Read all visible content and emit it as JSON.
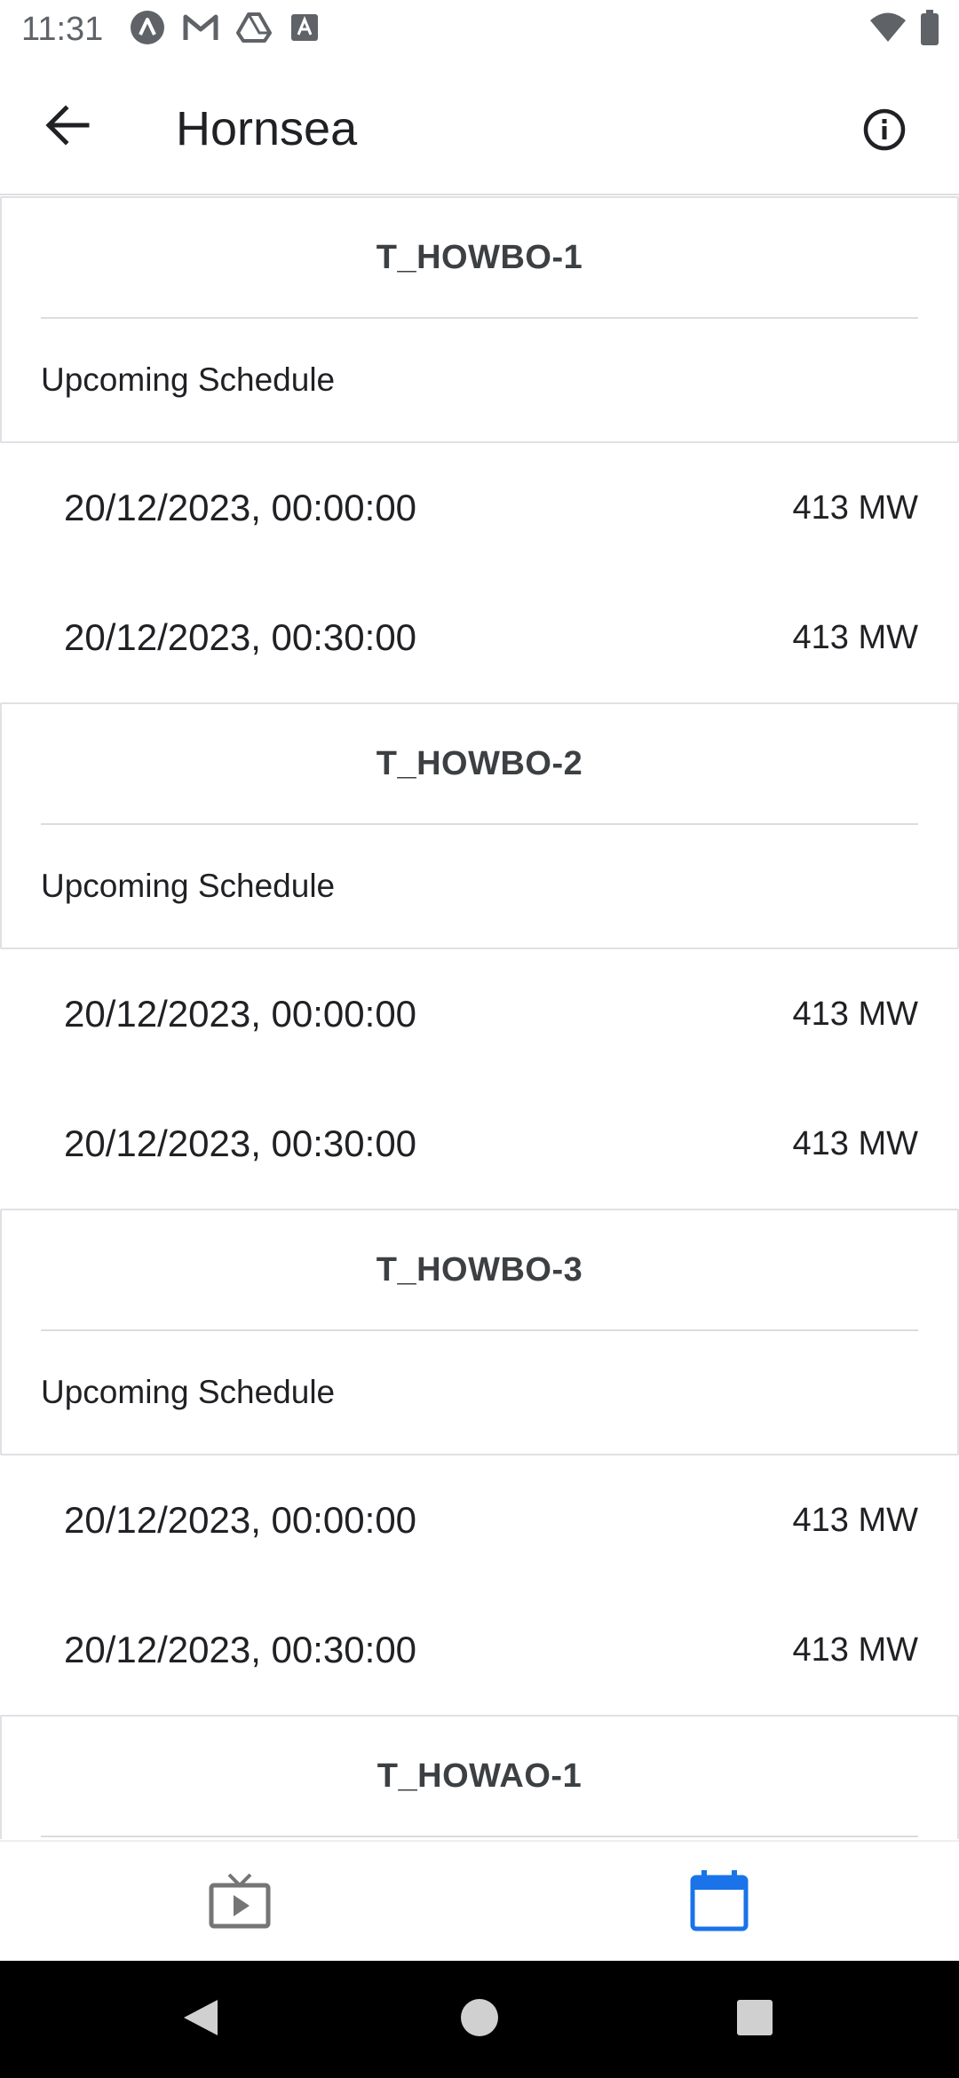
{
  "status_bar": {
    "time": "11:31",
    "left_icons": [
      "app-a-icon",
      "gmail-icon",
      "drive-icon",
      "font-a-icon"
    ],
    "right_icons": [
      "wifi-icon",
      "battery-icon"
    ]
  },
  "app_bar": {
    "title": "Hornsea",
    "back_icon": "arrow-left-icon",
    "info_icon": "info-icon"
  },
  "units": [
    {
      "name": "T_HOWBO-1",
      "schedule_label": "Upcoming Schedule",
      "rows": [
        {
          "time": "20/12/2023, 00:00:00",
          "value": "413 MW"
        },
        {
          "time": "20/12/2023, 00:30:00",
          "value": "413 MW"
        }
      ]
    },
    {
      "name": "T_HOWBO-2",
      "schedule_label": "Upcoming Schedule",
      "rows": [
        {
          "time": "20/12/2023, 00:00:00",
          "value": "413 MW"
        },
        {
          "time": "20/12/2023, 00:30:00",
          "value": "413 MW"
        }
      ]
    },
    {
      "name": "T_HOWBO-3",
      "schedule_label": "Upcoming Schedule",
      "rows": [
        {
          "time": "20/12/2023, 00:00:00",
          "value": "413 MW"
        },
        {
          "time": "20/12/2023, 00:30:00",
          "value": "413 MW"
        }
      ]
    },
    {
      "name": "T_HOWAO-1",
      "schedule_label": "",
      "rows": []
    }
  ],
  "bottom_nav": {
    "items": [
      {
        "icon": "live-tv-icon",
        "active": false
      },
      {
        "icon": "calendar-icon",
        "active": true
      }
    ],
    "active_color": "#1a73e8",
    "inactive_color": "#757575"
  },
  "system_nav": [
    "back-triangle-icon",
    "home-circle-icon",
    "recents-square-icon"
  ]
}
